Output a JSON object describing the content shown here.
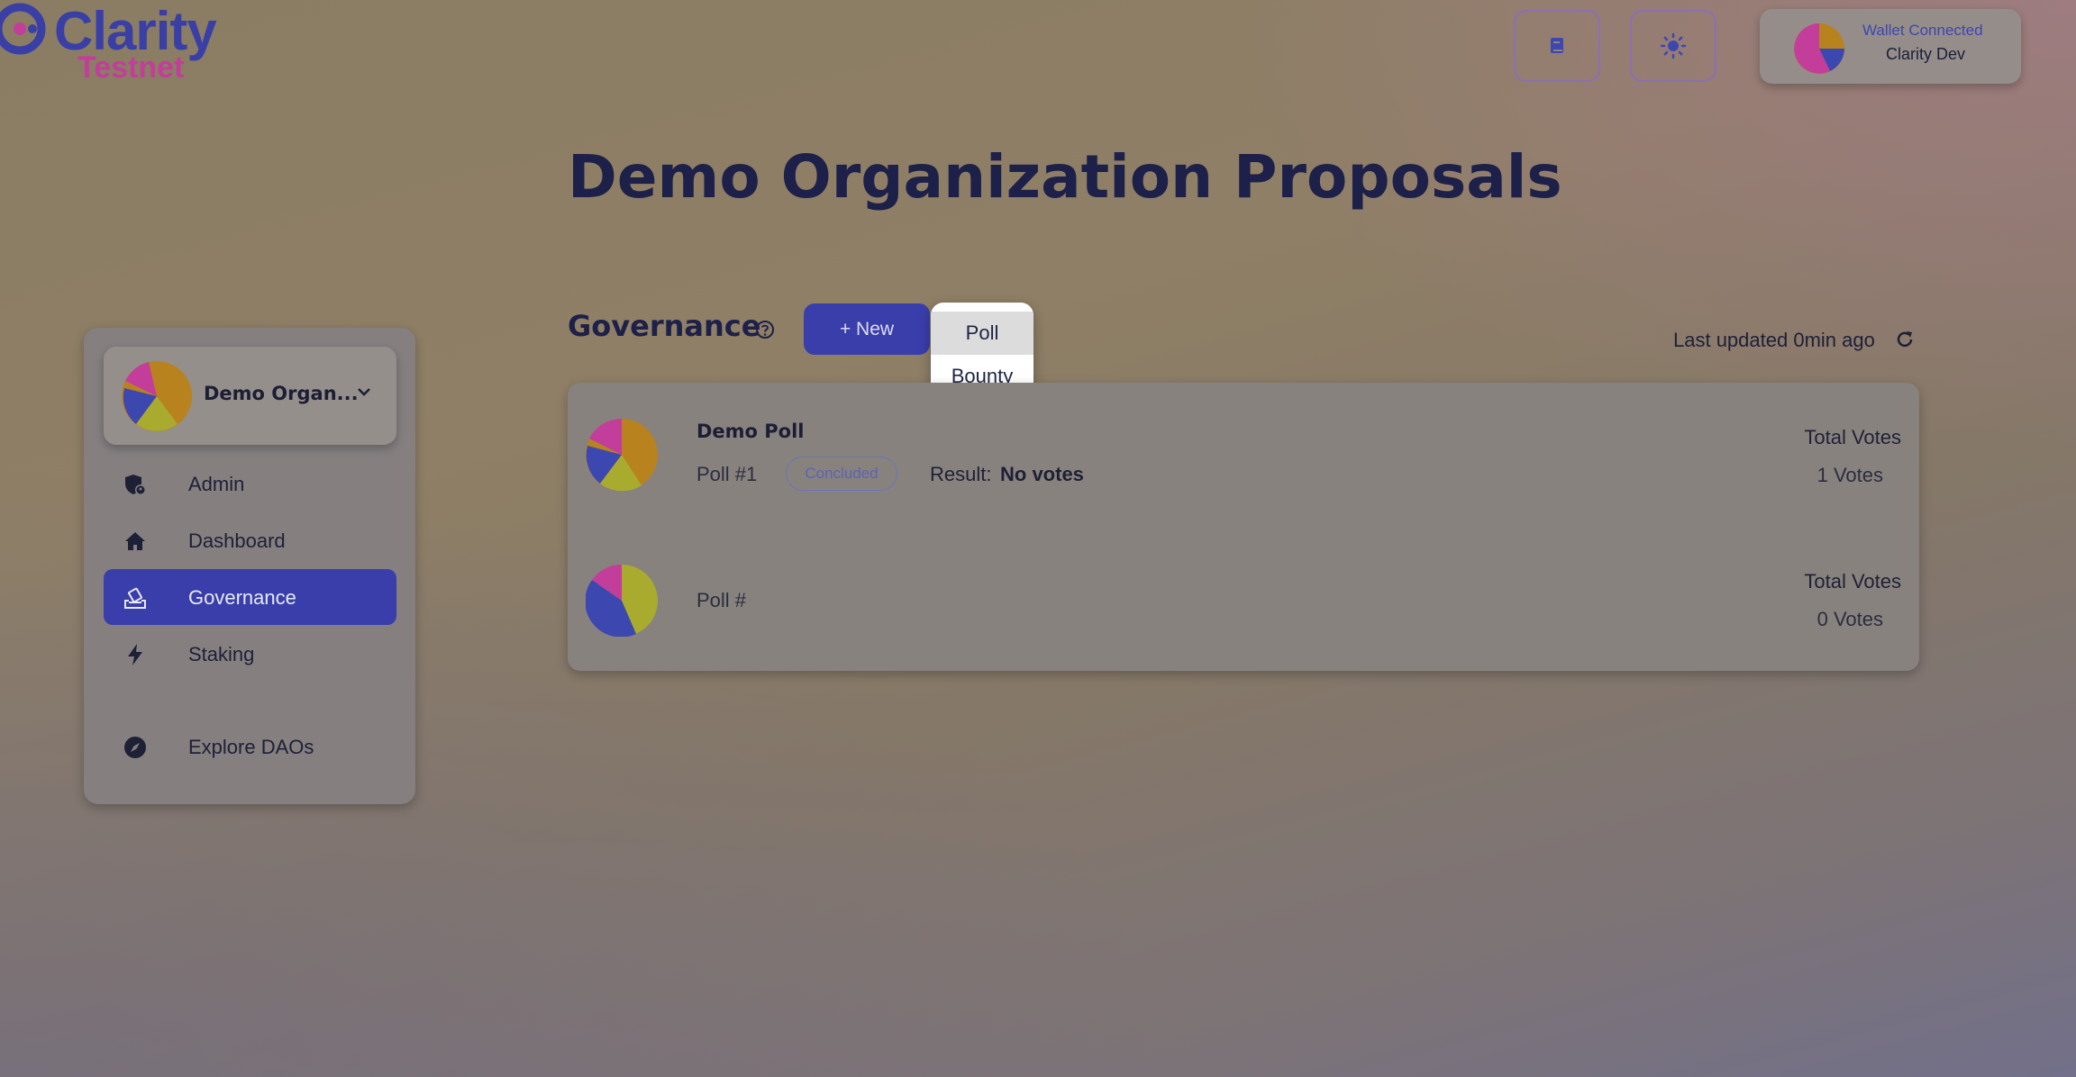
{
  "brand": {
    "name": "Clarity",
    "network": "Testnet",
    "colors": {
      "primary": "#3a3eaa",
      "accent": "#c33d9b"
    }
  },
  "topbar": {
    "docs_icon": "book-icon",
    "theme_icon": "sun-icon",
    "wallet": {
      "status": "Wallet Connected",
      "name": "Clarity Dev"
    }
  },
  "page": {
    "title": "Demo Organization Proposals"
  },
  "sidebar": {
    "org_name": "Demo Organ...",
    "items": [
      {
        "label": "Admin",
        "icon": "shield-user-icon",
        "active": false
      },
      {
        "label": "Dashboard",
        "icon": "home-icon",
        "active": false
      },
      {
        "label": "Governance",
        "icon": "ballot-icon",
        "active": true
      },
      {
        "label": "Staking",
        "icon": "bolt-icon",
        "active": false
      },
      {
        "label": "Explore DAOs",
        "icon": "compass-icon",
        "active": false
      }
    ]
  },
  "governance": {
    "title": "Governance",
    "new_button": "+ New",
    "menu": [
      "Poll",
      "Bounty"
    ],
    "last_updated": "Last updated 0min ago",
    "proposals": [
      {
        "title": "Demo Poll",
        "number": "Poll #1",
        "status": "Concluded",
        "result_label": "Result:",
        "result_value": "No votes",
        "total_votes_label": "Total Votes",
        "votes": "1 Votes"
      },
      {
        "title": "",
        "number": "Poll #",
        "total_votes_label": "Total Votes",
        "votes": "0 Votes"
      }
    ]
  }
}
